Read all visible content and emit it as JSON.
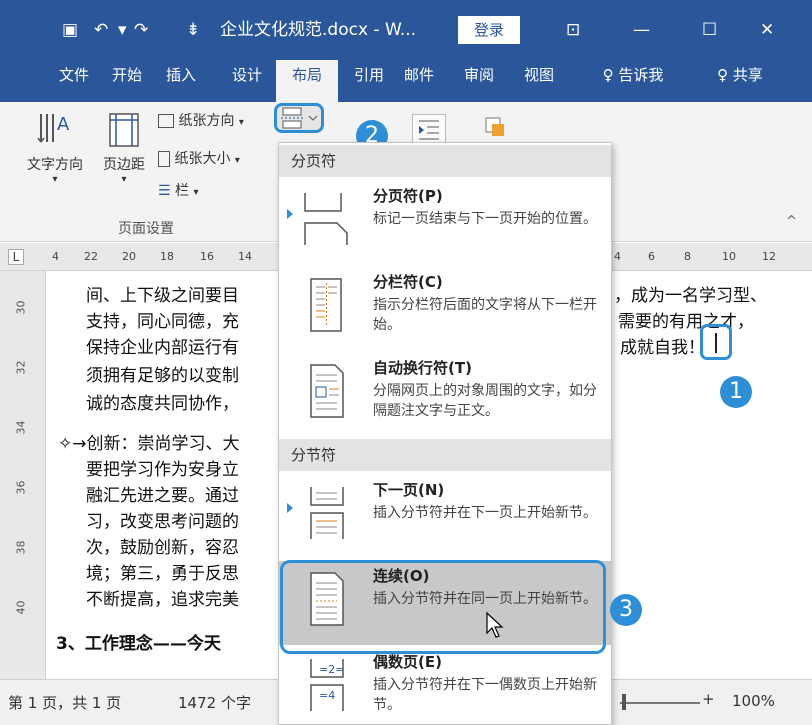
{
  "titlebar": {
    "doc_title": "企业文化规范.docx - W...",
    "login": "登录",
    "save_icon": "▣",
    "undo": "↶",
    "undo_dd": "▾",
    "redo": "↷",
    "qat_dd": "⇟",
    "ribbon_display": "⊡",
    "minimize": "—",
    "maximize": "☐",
    "close": "✕"
  },
  "tabs": {
    "file": "文件",
    "home": "开始",
    "insert": "插入",
    "design": "设计",
    "layout": "布局",
    "references": "引用",
    "mailings": "邮件",
    "review": "审阅",
    "view": "视图",
    "tellme": "♀ 告诉我",
    "share": "♀ 共享"
  },
  "ribbon": {
    "text_direction": "文字方向",
    "margins": "页边距",
    "orientation": "纸张方向",
    "size": "纸张大小",
    "columns": "栏",
    "group_label": "页面设置",
    "collapse": "^",
    "dd_arrow": "▾"
  },
  "ruler": {
    "corner": "L",
    "ticks_left": [
      "4",
      "22",
      "20",
      "18",
      "16",
      "14"
    ],
    "ticks_right": [
      "4",
      "6",
      "8",
      "10",
      "12"
    ]
  },
  "vruler": {
    "ticks": [
      "30",
      "32",
      "34",
      "36",
      "38",
      "40"
    ]
  },
  "document": {
    "line1_left": "间、上下级之间要目",
    "line1_right": "，成为一名学习型、",
    "line2_left": "支持，同心同德，充",
    "line2_right": "需要的有用之才，",
    "line3_left": "保持企业内部运行有",
    "line3_right": "成就自我！",
    "line4_left": "须拥有足够的以变制",
    "line5_left": "诚的态度共同协作，",
    "line6_left": "✧→创新：崇尚学习、大",
    "line7_left": "要把学习作为安身立",
    "line8_left": "融汇先进之要。通过",
    "line9_left": "习，改变思考问题的",
    "line10_left": "次，鼓励创新，容忍",
    "line11_left": "境；第三，勇于反思",
    "line12_left": "不断提高，追求完美",
    "heading": "3、工作理念——今天"
  },
  "badges": {
    "one": "1",
    "two": "2",
    "three": "3"
  },
  "menu": {
    "section_page_breaks": "分页符",
    "section_section_breaks": "分节符",
    "items": [
      {
        "title": "分页符(P)",
        "desc": "标记一页结束与下一页开始的位置。"
      },
      {
        "title": "分栏符(C)",
        "desc": "指示分栏符后面的文字将从下一栏开始。"
      },
      {
        "title": "自动换行符(T)",
        "desc": "分隔网页上的对象周围的文字，如分隔题注文字与正文。"
      },
      {
        "title": "下一页(N)",
        "desc": "插入分节符并在下一页上开始新节。"
      },
      {
        "title": "连续(O)",
        "desc": "插入分节符并在同一页上开始新节。"
      },
      {
        "title": "偶数页(E)",
        "desc": "插入分节符并在下一偶数页上开始新节。"
      }
    ]
  },
  "status": {
    "page": "第 1 页，共 1 页",
    "words": "1472 个字",
    "zoom_minus": "−",
    "zoom_plus": "+",
    "zoom_level": "100%"
  },
  "colors": {
    "brand": "#2b579a",
    "highlight": "#2f8fd6"
  }
}
